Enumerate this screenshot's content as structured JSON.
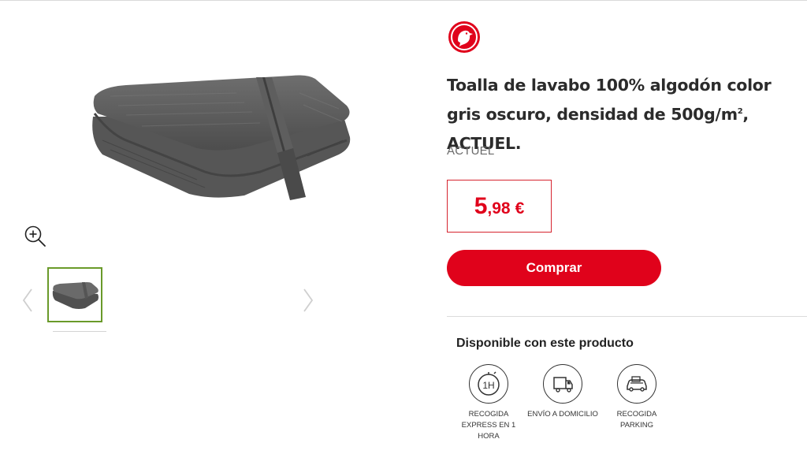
{
  "product": {
    "title_main": "Toalla de lavabo 100% algodón color gris oscuro, densidad de 500g/m",
    "title_sup": "2",
    "title_tail": ", ACTUEL.",
    "brand": "ACTUEL",
    "price_int": "5",
    "price_dec": ",98",
    "price_currency": "€"
  },
  "actions": {
    "buy_label": "Comprar"
  },
  "availability": {
    "title": "Disponible con este producto",
    "services": [
      {
        "label": "RECOGIDA EXPRESS EN 1 HORA",
        "icon": "express-1h-icon",
        "icon_text": "1H"
      },
      {
        "label": "ENVÍO A DOMICILIO",
        "icon": "home-delivery-icon"
      },
      {
        "label": "RECOGIDA PARKING",
        "icon": "parking-pickup-icon"
      }
    ]
  },
  "colors": {
    "accent": "#e0021b",
    "thumb_border": "#6a9a2a"
  }
}
